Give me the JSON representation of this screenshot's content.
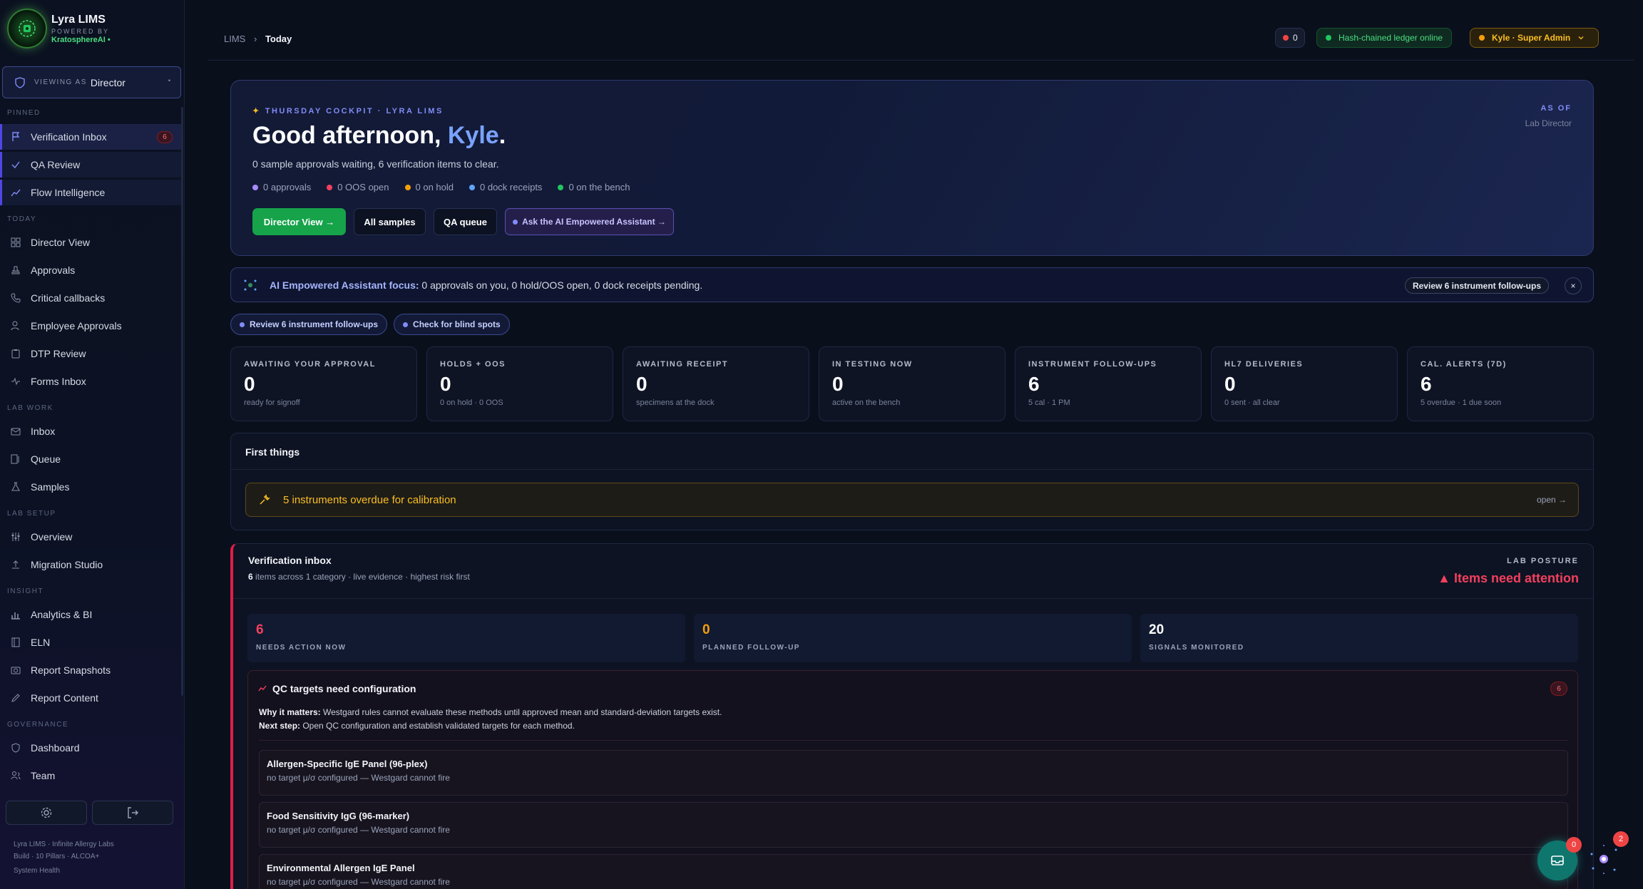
{
  "brand": {
    "title": "Lyra LIMS",
    "powered_by": "POWERED BY",
    "company": "KratosphereAI •"
  },
  "viewing_as": {
    "label": "VIEWING AS",
    "role": "Director",
    "caret": "•"
  },
  "sidebar": {
    "sections": {
      "pinned": "PINNED",
      "today": "TODAY",
      "lab_work": "LAB WORK",
      "lab_setup": "LAB SETUP",
      "insight": "INSIGHT",
      "governance": "GOVERNANCE"
    },
    "pinned": [
      {
        "label": "Verification Inbox",
        "badge": "6",
        "icon": "flag-icon"
      },
      {
        "label": "QA Review",
        "icon": "check-icon"
      },
      {
        "label": "Flow Intelligence",
        "icon": "trend-icon"
      }
    ],
    "today": [
      {
        "label": "Director View",
        "icon": "grid-icon"
      },
      {
        "label": "Approvals",
        "icon": "stamp-icon"
      },
      {
        "label": "Critical callbacks",
        "icon": "phone-icon"
      },
      {
        "label": "Employee Approvals",
        "icon": "user-check-icon"
      },
      {
        "label": "DTP Review",
        "icon": "clipboard-icon"
      },
      {
        "label": "Forms Inbox",
        "icon": "pulse-icon"
      }
    ],
    "lab_work": [
      {
        "label": "Inbox",
        "icon": "inbox-icon"
      },
      {
        "label": "Queue",
        "icon": "queue-icon"
      },
      {
        "label": "Samples",
        "icon": "flask-icon"
      }
    ],
    "lab_setup": [
      {
        "label": "Overview",
        "icon": "sliders-icon"
      },
      {
        "label": "Migration Studio",
        "icon": "upload-icon"
      }
    ],
    "insight": [
      {
        "label": "Analytics & BI",
        "icon": "bar-chart-icon"
      },
      {
        "label": "ELN",
        "icon": "notebook-icon"
      },
      {
        "label": "Report Snapshots",
        "icon": "camera-icon"
      },
      {
        "label": "Report Content",
        "icon": "pen-icon"
      }
    ],
    "governance": [
      {
        "label": "Dashboard",
        "icon": "shield-icon"
      },
      {
        "label": "Team",
        "icon": "users-icon"
      }
    ],
    "footer": {
      "line1": "Lyra LIMS · Infinite Allergy Labs",
      "line2": "Build · 10 Pillars · ALCOA+",
      "health": "System Health"
    }
  },
  "topbar": {
    "crumb_root": "LIMS",
    "crumb_sep": "›",
    "crumb_current": "Today",
    "alert_count": "0",
    "ledger_status": "Hash-chained ledger online",
    "user": "Kyle · Super Admin"
  },
  "hero": {
    "eyebrow": "THURSDAY COCKPIT · LYRA LIMS",
    "greeting": "Good afternoon, ",
    "name": "Kyle",
    "period": ".",
    "subtitle": "0 sample approvals waiting, 6 verification items to clear.",
    "as_of_label": "AS OF",
    "as_of_value": "Lab Director",
    "stats": [
      {
        "text": "0 approvals",
        "color": "#a78bfa"
      },
      {
        "text": "0 OOS open",
        "color": "#f43f5e"
      },
      {
        "text": "0 on hold",
        "color": "#f59e0b"
      },
      {
        "text": "0 dock receipts",
        "color": "#60a5fa"
      },
      {
        "text": "0 on the bench",
        "color": "#22c55e"
      }
    ],
    "actions": {
      "director": "Director View →",
      "all_samples": "All samples",
      "qa_queue": "QA queue",
      "ai": "Ask the AI Empowered Assistant →"
    }
  },
  "focus": {
    "label": "AI Empowered Assistant focus:",
    "text": " 0 approvals on you, 0 hold/OOS open, 0 dock receipts pending.",
    "button": "Review 6 instrument follow-ups",
    "close": "×"
  },
  "chips": [
    "Review 6 instrument follow-ups",
    "Check for blind spots"
  ],
  "kpis": [
    {
      "label": "AWAITING YOUR APPROVAL",
      "value": "0",
      "sub": "ready for signoff"
    },
    {
      "label": "HOLDS + OOS",
      "value": "0",
      "sub": "0 on hold · 0 OOS"
    },
    {
      "label": "AWAITING RECEIPT",
      "value": "0",
      "sub": "specimens at the dock"
    },
    {
      "label": "IN TESTING NOW",
      "value": "0",
      "sub": "active on the bench"
    },
    {
      "label": "INSTRUMENT FOLLOW-UPS",
      "value": "6",
      "sub": "5 cal · 1 PM"
    },
    {
      "label": "HL7 DELIVERIES",
      "value": "0",
      "sub": "0 sent · all clear"
    },
    {
      "label": "CAL. ALERTS (7D)",
      "value": "6",
      "sub": "5 overdue · 1 due soon"
    }
  ],
  "first_things": {
    "title": "First things",
    "warning": "5 instruments overdue for calibration",
    "open": "open →"
  },
  "verification": {
    "title": "Verification inbox",
    "count": "6",
    "summary": " items across 1 category · live evidence · highest risk first",
    "posture_label": "LAB POSTURE",
    "posture_value": "▲ Items need attention",
    "stats": [
      {
        "value": "6",
        "label": "NEEDS ACTION NOW",
        "color": "#f43f5e"
      },
      {
        "value": "0",
        "label": "PLANNED FOLLOW-UP",
        "color": "#f59e0b"
      },
      {
        "value": "20",
        "label": "SIGNALS MONITORED",
        "color": "#ffffff"
      }
    ],
    "qc": {
      "title": "QC targets need configuration",
      "badge": "6",
      "why_label": "Why it matters:",
      "why_text": " Westgard rules cannot evaluate these methods until approved mean and standard-deviation targets exist.",
      "next_label": "Next step:",
      "next_text": " Open QC configuration and establish validated targets for each method.",
      "items": [
        {
          "name": "Allergen-Specific IgE Panel (96-plex)",
          "detail": "no target μ/σ configured — Westgard cannot fire"
        },
        {
          "name": "Food Sensitivity IgG (96-marker)",
          "detail": "no target μ/σ configured — Westgard cannot fire"
        },
        {
          "name": "Environmental Allergen IgE Panel",
          "detail": "no target μ/σ configured — Westgard cannot fire"
        }
      ]
    }
  },
  "floating": {
    "inbox_badge": "0",
    "assistant_badge": "2"
  }
}
